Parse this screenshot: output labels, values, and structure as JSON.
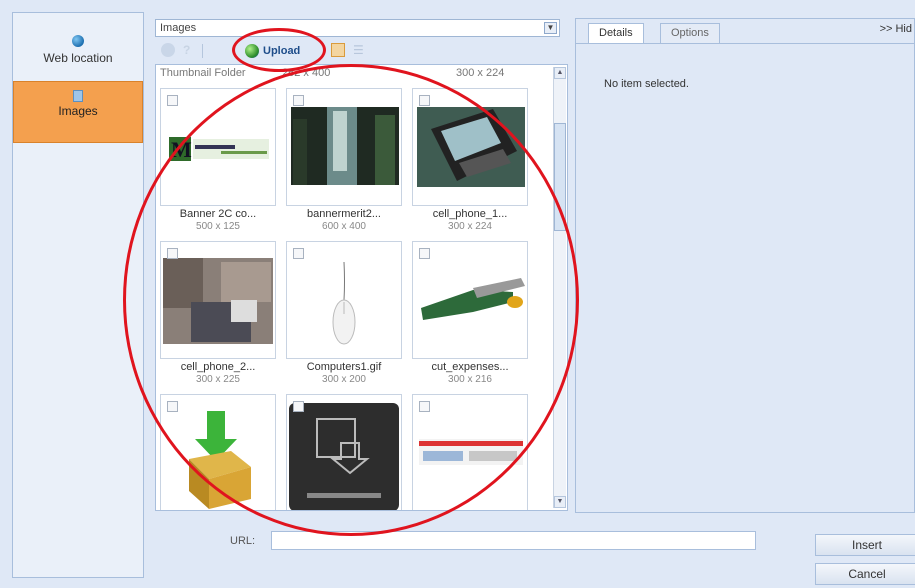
{
  "sources": {
    "web_location": "Web location",
    "images": "Images"
  },
  "folder_combo": {
    "value": "Images"
  },
  "toolbar": {
    "upload_label": "Upload"
  },
  "grid": {
    "cut_row": [
      {
        "name": "Thumbnail Folder",
        "dim": "262 x 400"
      },
      {
        "name": "",
        "dim": "300 x 224"
      }
    ],
    "items": [
      {
        "name": "Banner 2C co...",
        "dim": "500 x 125",
        "thumb": "banner"
      },
      {
        "name": "bannermerit2...",
        "dim": "600 x 400",
        "thumb": "forest"
      },
      {
        "name": "cell_phone_1...",
        "dim": "300 x 224",
        "thumb": "phone"
      },
      {
        "name": "cell_phone_2...",
        "dim": "300 x 225",
        "thumb": "street"
      },
      {
        "name": "Computers1.gif",
        "dim": "300 x 200",
        "thumb": "mouse"
      },
      {
        "name": "cut_expenses...",
        "dim": "300 x 216",
        "thumb": "scissors"
      },
      {
        "name": "",
        "dim": "",
        "thumb": "box-arrow"
      },
      {
        "name": "",
        "dim": "",
        "thumb": "download"
      },
      {
        "name": "",
        "dim": "",
        "thumb": "webbanner"
      }
    ]
  },
  "details": {
    "tab_details": "Details",
    "tab_options": "Options",
    "hide_label": ">> Hid",
    "empty_message": "No item selected."
  },
  "bottom": {
    "url_label": "URL:",
    "url_value": "",
    "insert_label": "Insert",
    "cancel_label": "Cancel"
  },
  "colors": {
    "selected_source": "#f4a04e",
    "annotation": "#e0141e",
    "panel_bg": "#dfe8f6"
  }
}
